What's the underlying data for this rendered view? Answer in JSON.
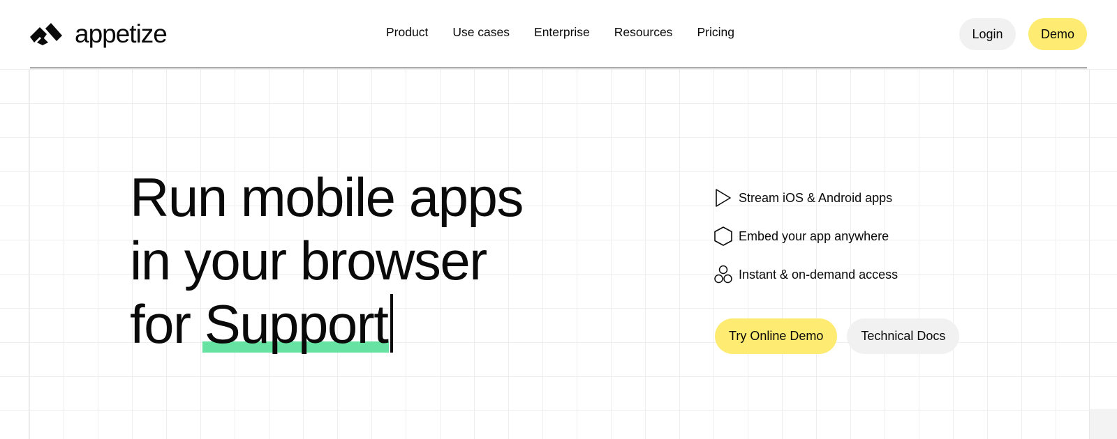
{
  "brand": {
    "name": "appetize",
    "accent_yellow": "#fdeb72",
    "highlight_green": "#66e2a2",
    "logo_icon": "appetize-logo-icon"
  },
  "nav": {
    "items": [
      {
        "label": "Product"
      },
      {
        "label": "Use cases"
      },
      {
        "label": "Enterprise"
      },
      {
        "label": "Resources"
      },
      {
        "label": "Pricing"
      }
    ],
    "login_label": "Login",
    "demo_label": "Demo"
  },
  "hero": {
    "line1": "Run mobile apps",
    "line2": "in your browser",
    "line3_prefix": "for",
    "highlight_word": "Support"
  },
  "features": [
    {
      "icon": "play-triangle-icon",
      "label": "Stream iOS & Android apps"
    },
    {
      "icon": "hexagon-icon",
      "label": "Embed your app anywhere"
    },
    {
      "icon": "circles-cluster-icon",
      "label": "Instant & on-demand access"
    }
  ],
  "cta": {
    "primary_label": "Try Online Demo",
    "secondary_label": "Technical Docs"
  }
}
